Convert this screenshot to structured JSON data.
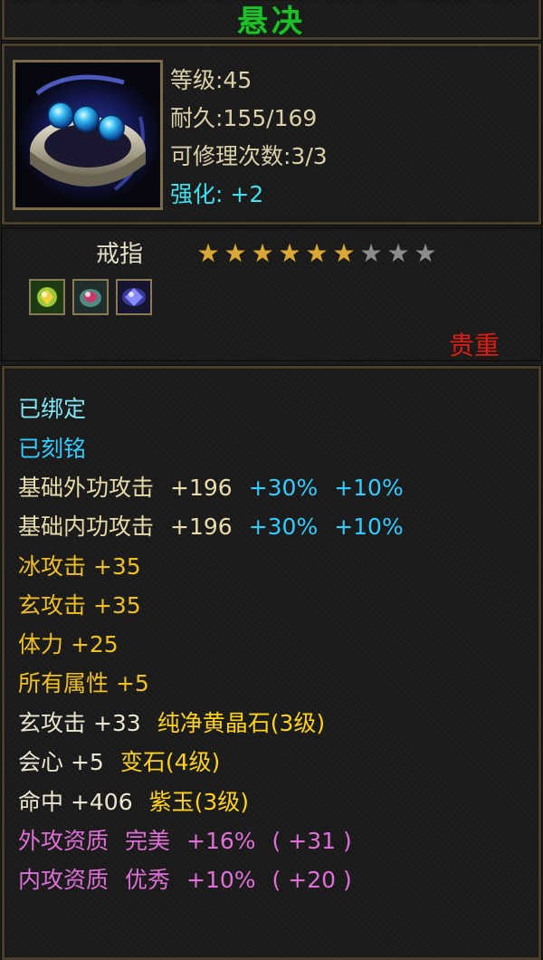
{
  "item": {
    "name": "悬决",
    "icon": "ring-with-blue-gems-icon",
    "stats": {
      "level": "等级:45",
      "durability": "耐久:155/169",
      "repair": "可修理次数:3/3",
      "enhance": "强化: +2"
    },
    "type": "戒指",
    "stars": {
      "filled": 6,
      "total": 9
    },
    "gem_slots": [
      "yellow-gem-slot-icon",
      "red-gem-slot-icon",
      "purple-gem-slot-icon"
    ],
    "rarity": "贵重"
  },
  "attributes": {
    "bound": "已绑定",
    "engraved": "已刻铭",
    "ext_attack": {
      "label": "基础外功攻击",
      "value": "+196",
      "bonus1": "+30%",
      "bonus2": "+10%"
    },
    "int_attack": {
      "label": "基础内功攻击",
      "value": "+196",
      "bonus1": "+30%",
      "bonus2": "+10%"
    },
    "ice_attack": "冰攻击 +35",
    "mystic_attack": "玄攻击 +35",
    "stamina": "体力 +25",
    "all_attrs": "所有属性 +5",
    "gem1": {
      "stat": "玄攻击 +33",
      "gem": "纯净黄晶石(3级)"
    },
    "gem2": {
      "stat": "会心 +5",
      "gem": "变石(4级)"
    },
    "gem3": {
      "stat": "命中 +406",
      "gem": "紫玉(3级)"
    },
    "ext_quality": {
      "label": "外攻资质",
      "grade": "完美",
      "value": "+16%",
      "extra": "( +31 )"
    },
    "int_quality": {
      "label": "内攻资质",
      "grade": "优秀",
      "value": "+10%",
      "extra": "( +20 )"
    }
  },
  "colors": {
    "title": "#1fbf2a",
    "rarity": "#e01c10",
    "star_on": "#d9a837",
    "star_off": "#8c8c8c"
  }
}
